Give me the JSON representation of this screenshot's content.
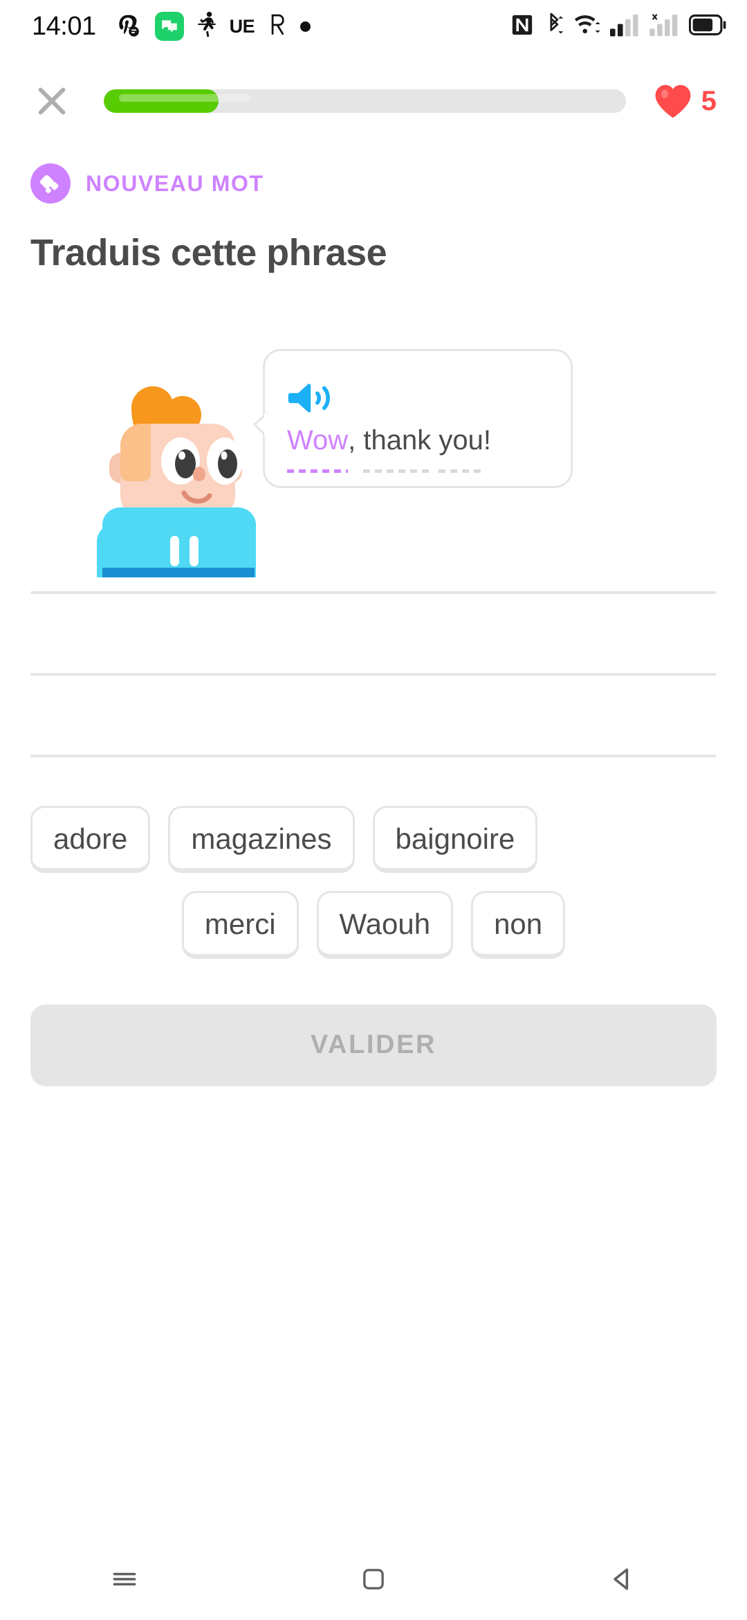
{
  "status_bar": {
    "time": "14:01",
    "left_icons": [
      "discord-icon",
      "messages-icon",
      "fitness-icon",
      "ue-icon",
      "r-app-icon",
      "dot-indicator-icon"
    ],
    "right_icons": [
      "nfc-icon",
      "bluetooth-icon",
      "wifi-icon",
      "signal-sim1-icon",
      "signal-sim2-no-service-icon",
      "battery-icon"
    ],
    "ue_label": "UE",
    "r_label": "R"
  },
  "lesson_header": {
    "close_label": "close-icon",
    "progress_percent": 22,
    "hearts": "5",
    "heart_color": "#ff4b4b",
    "progress_color": "#58cc02",
    "progress_track_color": "#e5e5e5"
  },
  "new_word": {
    "label": "NOUVEAU MOT",
    "color": "#ce82ff"
  },
  "challenge": {
    "title": "Traduis cette phrase",
    "speaker_icon": "speaker-icon",
    "sentence_tokens": [
      {
        "text": "Wow",
        "is_new": true,
        "underlined": true
      },
      {
        "text": ",",
        "is_new": false,
        "underlined": false
      },
      {
        "text": " ",
        "is_new": false,
        "underlined": false
      },
      {
        "text": "thank",
        "is_new": false,
        "underlined": true
      },
      {
        "text": " ",
        "is_new": false,
        "underlined": false
      },
      {
        "text": "you",
        "is_new": false,
        "underlined": true
      },
      {
        "text": "!",
        "is_new": false,
        "underlined": false
      }
    ],
    "sentence_plain": "Wow, thank you!",
    "character": "duo-character-junior"
  },
  "answer_area": {
    "line_count": 3,
    "entered_words": []
  },
  "word_bank": {
    "row1": [
      "adore",
      "magazines",
      "baignoire"
    ],
    "row2": [
      "merci",
      "Waouh",
      "non"
    ]
  },
  "check_button": {
    "label": "VALIDER",
    "enabled": false
  },
  "nav_bar": {
    "items": [
      "recents-icon",
      "home-icon",
      "back-icon"
    ]
  }
}
